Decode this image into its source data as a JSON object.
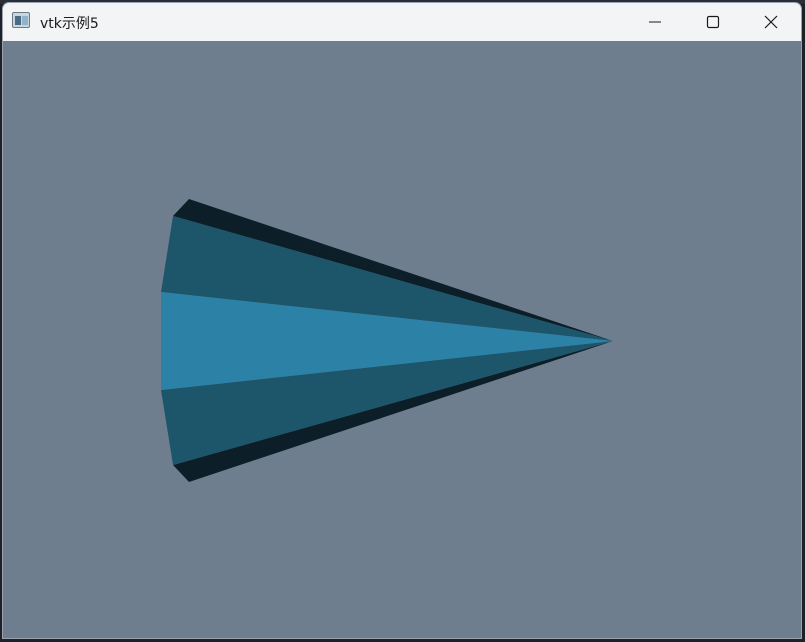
{
  "window": {
    "title": "vtk示例5",
    "controls": {
      "minimize": "minimize-icon",
      "maximize": "maximize-icon",
      "close": "close-icon"
    }
  },
  "render_view": {
    "background_color": "#6f7e8f",
    "object": "cone",
    "face_colors": {
      "front": "#2b81a6",
      "side_mid": "#1d566b",
      "side_dark": "#0c1f29"
    }
  }
}
